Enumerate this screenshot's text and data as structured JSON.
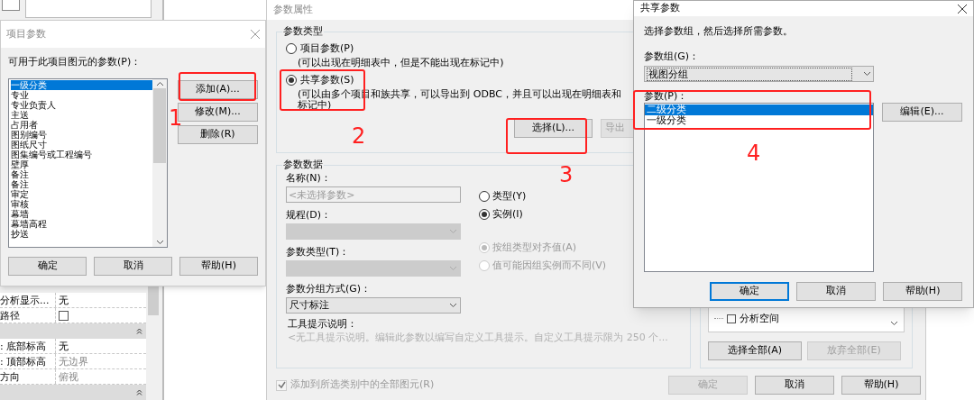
{
  "background": {
    "properties": [
      {
        "kind": "text",
        "name": "分析显示...",
        "value": "无",
        "disabled": false
      },
      {
        "kind": "checkbox",
        "name": "路径",
        "checked": false
      },
      {
        "kind": "header"
      },
      {
        "kind": "text",
        "name": ": 底部标高",
        "value": "无",
        "disabled": false
      },
      {
        "kind": "text",
        "name": ": 顶部标高",
        "value": "无边界",
        "disabled": true
      },
      {
        "kind": "text",
        "name": "方向",
        "value": "俯视",
        "disabled": true
      },
      {
        "kind": "header"
      }
    ]
  },
  "project_params_dialog": {
    "title": "项目参数",
    "list_label": "可用于此项目图元的参数(P)：",
    "items": [
      {
        "label": "一级分类",
        "selected": true
      },
      {
        "label": "专业",
        "selected": false
      },
      {
        "label": "专业负责人",
        "selected": false
      },
      {
        "label": "主送",
        "selected": false
      },
      {
        "label": "占用者",
        "selected": false
      },
      {
        "label": "图别编号",
        "selected": false
      },
      {
        "label": "图纸尺寸",
        "selected": false
      },
      {
        "label": "图集编号或工程编号",
        "selected": false
      },
      {
        "label": "壁厚",
        "selected": false
      },
      {
        "label": "备注",
        "selected": false
      },
      {
        "label": "备注",
        "selected": false
      },
      {
        "label": "审定",
        "selected": false
      },
      {
        "label": "审核",
        "selected": false
      },
      {
        "label": "幕墙",
        "selected": false
      },
      {
        "label": "幕墙高程",
        "selected": false
      },
      {
        "label": "抄送",
        "selected": false
      }
    ],
    "side_buttons": [
      "添加(A)...",
      "修改(M)...",
      "删除(R)"
    ],
    "buttons": [
      "确定",
      "取消",
      "帮助(H)"
    ]
  },
  "param_props_dialog": {
    "title": "参数属性",
    "type_group": {
      "title": "参数类型",
      "options": [
        {
          "label": "项目参数(P)",
          "description": "(可以出现在明细表中，但是不能出现在标记中)",
          "selected": false
        },
        {
          "label": "共享参数(S)",
          "description": "(可以由多个项目和族共享，可以导出到 ODBC，并且可以出现在明细表和标记中)",
          "selected": true
        }
      ],
      "buttons": [
        {
          "label": "选择(L)...",
          "disabled": false
        },
        {
          "label": "导出",
          "disabled": true
        }
      ]
    },
    "data_group": {
      "title": "参数数据",
      "fields": [
        {
          "kind": "input",
          "label": "名称(N)：",
          "placeholder": "<未选择参数>"
        },
        {
          "kind": "select",
          "label": "规程(D)：",
          "disabled": true
        },
        {
          "kind": "select",
          "label": "参数类型(T)：",
          "disabled": true
        },
        {
          "kind": "select",
          "label": "参数分组方式(G)：",
          "value": "尺寸标注",
          "disabled": false
        }
      ],
      "scope_options": [
        {
          "label": "类型(Y)",
          "selected": false,
          "disabled": false
        },
        {
          "label": "实例(I)",
          "selected": true,
          "disabled": false
        }
      ],
      "group_options": [
        {
          "label": "按组类型对齐值(A)",
          "selected": true,
          "disabled": true
        },
        {
          "label": "值可能因组实例而不同(V)",
          "selected": false,
          "disabled": true
        }
      ],
      "tooltip_label": "工具提示说明：",
      "tooltip_text": "<无工具提示说明。编辑此参数以编写自定义工具提示。自定义工具提示限为 250 个..."
    },
    "categories": {
      "items": [
        {
          "label": "分析空间",
          "checked": false
        }
      ],
      "buttons": [
        {
          "label": "选择全部(A)",
          "disabled": false
        },
        {
          "label": "放弃全部(E)",
          "disabled": true
        }
      ]
    },
    "add_all": {
      "label": "添加到所选类别中的全部图元(R)",
      "checked": true,
      "disabled": true
    },
    "buttons": [
      {
        "label": "确定",
        "disabled": true
      },
      {
        "label": "取消",
        "disabled": false
      },
      {
        "label": "帮助(H)",
        "disabled": false
      }
    ]
  },
  "shared_params_dialog": {
    "title": "共享参数",
    "instruction": "选择参数组，然后选择所需参数。",
    "group_label": "参数组(G)：",
    "group_value": "视图分组",
    "params_label": "参数(P)：",
    "params": [
      {
        "label": "二级分类",
        "selected": true
      },
      {
        "label": "一级分类",
        "selected": false
      }
    ],
    "edit_button": "编辑(E)...",
    "buttons": [
      {
        "label": "确定",
        "default": true
      },
      {
        "label": "取消",
        "default": false
      },
      {
        "label": "帮助(H)",
        "default": false
      }
    ]
  },
  "annotations": [
    {
      "number": "1"
    },
    {
      "number": "2"
    },
    {
      "number": "3"
    },
    {
      "number": "4"
    }
  ]
}
